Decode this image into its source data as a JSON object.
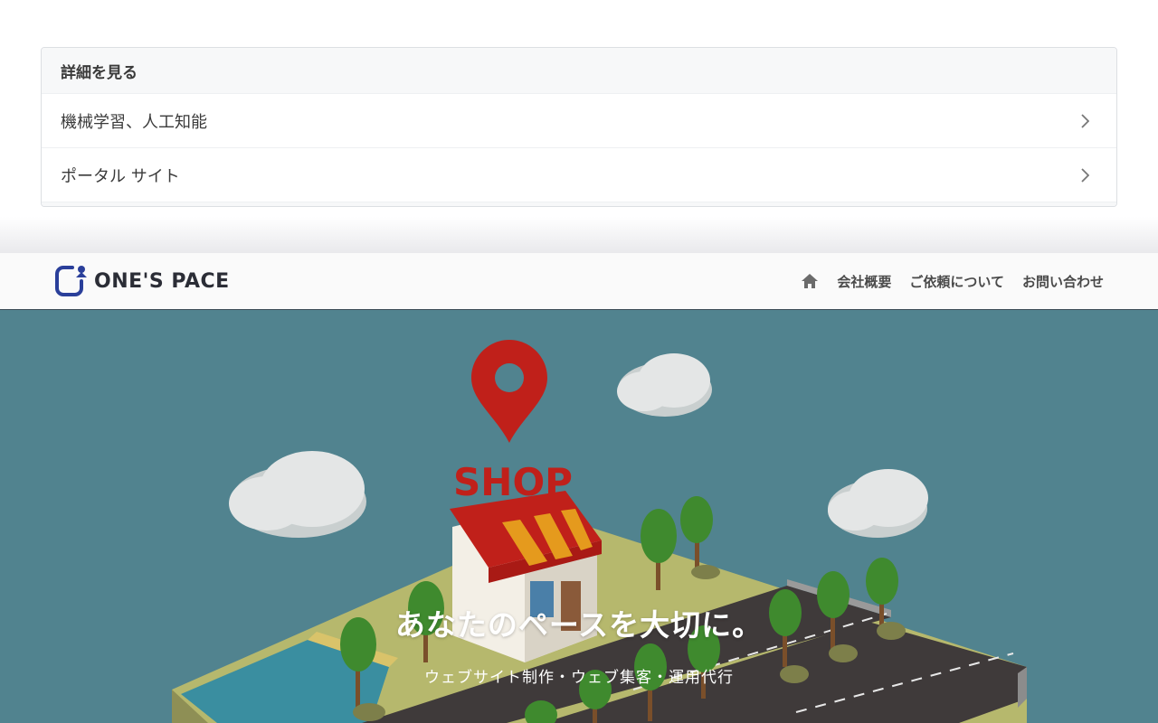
{
  "card": {
    "header": "詳細を見る",
    "items": [
      {
        "label": "機械学習、人工知能"
      },
      {
        "label": "ポータル サイト"
      }
    ]
  },
  "navbar": {
    "logo_text": "ONE'S PACE",
    "home_icon": "home-icon",
    "links": [
      {
        "label": "会社概要"
      },
      {
        "label": "ご依頼について"
      },
      {
        "label": "お問い合わせ"
      }
    ]
  },
  "hero": {
    "title": "あなたのペースを大切に。",
    "subtitle": "ウェブサイト制作・ウェブ集客・運用代行",
    "sign_text": "SHOP",
    "colors": {
      "background": "#51838f",
      "pin": "#c0201a",
      "awning_red": "#c0201a",
      "awning_orange": "#e59a1d",
      "grass": "#b5b86a",
      "road": "#3f3a3a",
      "water": "#3a8ea0",
      "tree": "#3f8a2e",
      "cloud": "#e8e8e8"
    }
  }
}
